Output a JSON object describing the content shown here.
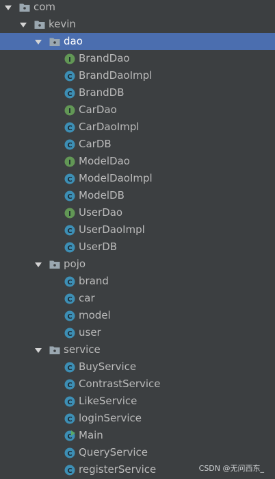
{
  "colors": {
    "background": "#3c3f41",
    "selection": "#4b6eaf",
    "text": "#bbbbbb",
    "folder": "#9aa7b0",
    "class_icon": "#3d8fb5",
    "interface_icon": "#629755",
    "runnable_badge": "#59a869"
  },
  "tree": {
    "rows": [
      {
        "label": "com",
        "depth": 0,
        "type": "package",
        "expanded": true,
        "icon": "package-folder-icon"
      },
      {
        "label": "kevin",
        "depth": 1,
        "type": "package",
        "expanded": true,
        "icon": "package-folder-icon"
      },
      {
        "label": "dao",
        "depth": 2,
        "type": "package",
        "expanded": true,
        "selected": true,
        "icon": "package-folder-icon"
      },
      {
        "label": "BrandDao",
        "depth": 3,
        "type": "interface",
        "icon": "interface-icon",
        "glyph": "I"
      },
      {
        "label": "BrandDaoImpl",
        "depth": 3,
        "type": "class",
        "icon": "class-icon",
        "glyph": "C"
      },
      {
        "label": "BrandDB",
        "depth": 3,
        "type": "class",
        "icon": "class-icon",
        "glyph": "C"
      },
      {
        "label": "CarDao",
        "depth": 3,
        "type": "interface",
        "icon": "interface-icon",
        "glyph": "I"
      },
      {
        "label": "CarDaoImpl",
        "depth": 3,
        "type": "class",
        "icon": "class-icon",
        "glyph": "C"
      },
      {
        "label": "CarDB",
        "depth": 3,
        "type": "class",
        "icon": "class-icon",
        "glyph": "C"
      },
      {
        "label": "ModelDao",
        "depth": 3,
        "type": "interface",
        "icon": "interface-icon",
        "glyph": "I"
      },
      {
        "label": "ModelDaoImpl",
        "depth": 3,
        "type": "class",
        "icon": "class-icon",
        "glyph": "C"
      },
      {
        "label": "ModelDB",
        "depth": 3,
        "type": "class",
        "icon": "class-icon",
        "glyph": "C"
      },
      {
        "label": "UserDao",
        "depth": 3,
        "type": "interface",
        "icon": "interface-icon",
        "glyph": "I"
      },
      {
        "label": "UserDaoImpl",
        "depth": 3,
        "type": "class",
        "icon": "class-icon",
        "glyph": "C"
      },
      {
        "label": "UserDB",
        "depth": 3,
        "type": "class",
        "icon": "class-icon",
        "glyph": "C"
      },
      {
        "label": "pojo",
        "depth": 2,
        "type": "package",
        "expanded": true,
        "icon": "package-folder-icon"
      },
      {
        "label": "brand",
        "depth": 3,
        "type": "class",
        "icon": "class-icon",
        "glyph": "C"
      },
      {
        "label": "car",
        "depth": 3,
        "type": "class",
        "icon": "class-icon",
        "glyph": "C"
      },
      {
        "label": "model",
        "depth": 3,
        "type": "class",
        "icon": "class-icon",
        "glyph": "C"
      },
      {
        "label": "user",
        "depth": 3,
        "type": "class",
        "icon": "class-icon",
        "glyph": "C"
      },
      {
        "label": "service",
        "depth": 2,
        "type": "package",
        "expanded": true,
        "icon": "package-folder-icon"
      },
      {
        "label": "BuyService",
        "depth": 3,
        "type": "class",
        "icon": "class-icon",
        "glyph": "C"
      },
      {
        "label": "ContrastService",
        "depth": 3,
        "type": "class",
        "icon": "class-icon",
        "glyph": "C"
      },
      {
        "label": "LikeService",
        "depth": 3,
        "type": "class",
        "icon": "class-icon",
        "glyph": "C"
      },
      {
        "label": "loginService",
        "depth": 3,
        "type": "class",
        "icon": "class-icon",
        "glyph": "C"
      },
      {
        "label": "Main",
        "depth": 3,
        "type": "main-class",
        "icon": "runnable-class-icon",
        "glyph": "C"
      },
      {
        "label": "QueryService",
        "depth": 3,
        "type": "class",
        "icon": "class-icon",
        "glyph": "C"
      },
      {
        "label": "registerService",
        "depth": 3,
        "type": "class",
        "icon": "class-icon",
        "glyph": "C"
      }
    ]
  },
  "watermark": "CSDN @无问西东_"
}
